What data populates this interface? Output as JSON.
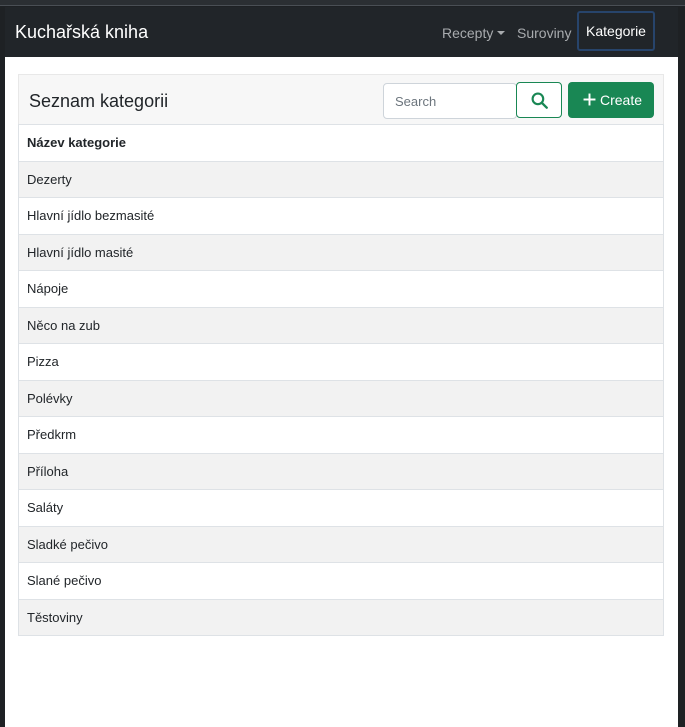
{
  "navbar": {
    "brand": "Kuchařská kniha",
    "items": [
      {
        "label": "Recepty",
        "dropdown": true
      },
      {
        "label": "Suroviny"
      },
      {
        "label": "Kategorie",
        "active": true
      }
    ]
  },
  "card": {
    "title": "Seznam kategorii",
    "search_placeholder": "Search",
    "search_value": "",
    "create_label": "Create"
  },
  "table": {
    "header": "Název kategorie",
    "rows": [
      "Dezerty",
      "Hlavní jídlo bezmasité",
      "Hlavní jídlo masité",
      "Nápoje",
      "Něco na zub",
      "Pizza",
      "Polévky",
      "Předkrm",
      "Příloha",
      "Saláty",
      "Sladké pečivo",
      "Slané pečivo",
      "Těstoviny"
    ]
  },
  "colors": {
    "navbar_bg": "#212529",
    "accent_green": "#198754",
    "active_outline": "#27446b",
    "stripe": "#f2f2f2"
  },
  "icons": {
    "search": "search-icon",
    "create": "plus-icon",
    "dropdown": "caret-down-icon"
  }
}
